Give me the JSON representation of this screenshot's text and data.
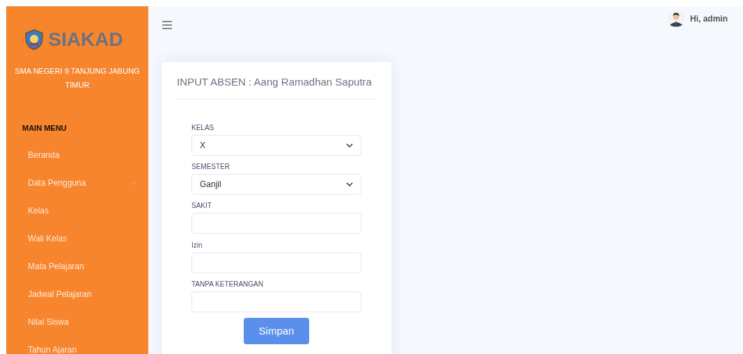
{
  "sidebar": {
    "brand": "SIAKAD",
    "school": "SMA NEGERI 9 TANJUNG JABUNG TIMUR",
    "section": "MAIN MENU",
    "items": [
      {
        "label": "Beranda",
        "kind": "link"
      },
      {
        "label": "Data Pengguna",
        "kind": "submenu",
        "expanded": false
      },
      {
        "label": "Kelas",
        "kind": "link"
      },
      {
        "label": "Wali Kelas",
        "kind": "link"
      },
      {
        "label": "Mata Pelajaran",
        "kind": "link"
      },
      {
        "label": "Jadwal Pelajaran",
        "kind": "link"
      },
      {
        "label": "Nilai Siswa",
        "kind": "link"
      },
      {
        "label": "Tahun Ajaran",
        "kind": "link"
      }
    ]
  },
  "topbar": {
    "user": "Hi, admin"
  },
  "form": {
    "title": "INPUT ABSEN : Aang Ramadhan Saputra",
    "fields": [
      {
        "label": "KELAS",
        "kind": "select",
        "value": "X"
      },
      {
        "label": "SEMESTER",
        "kind": "select",
        "value": "Ganjil"
      },
      {
        "label": "SAKIT",
        "kind": "text"
      },
      {
        "label": "Izin",
        "kind": "text"
      },
      {
        "label": "TANPA KETERANGAN",
        "kind": "text"
      }
    ],
    "submit": "Simpan"
  }
}
